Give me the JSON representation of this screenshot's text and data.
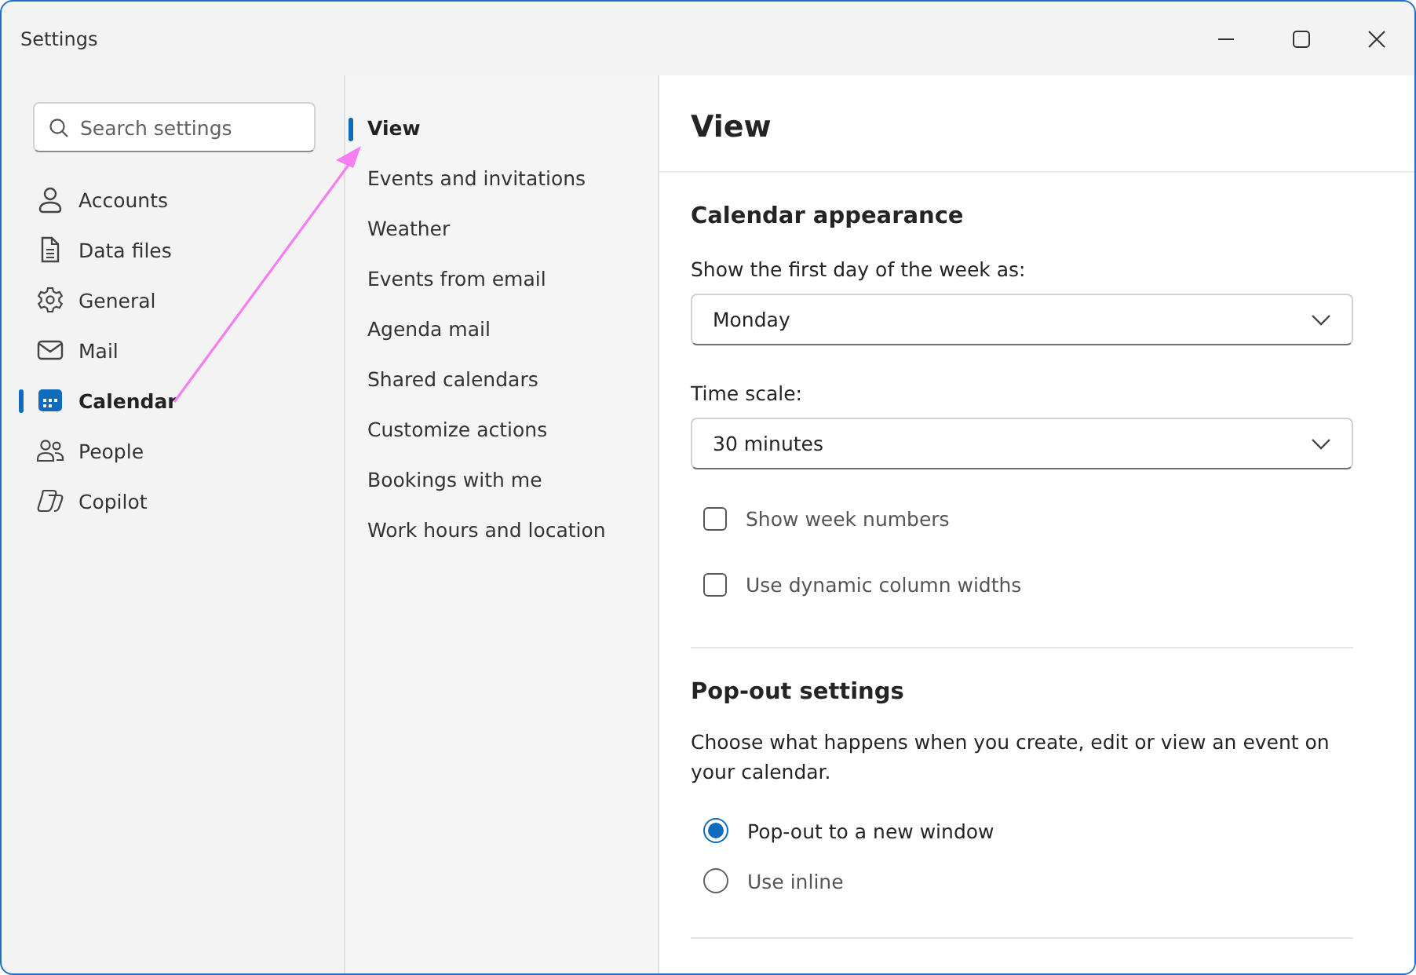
{
  "window": {
    "title": "Settings"
  },
  "search": {
    "placeholder": "Search settings"
  },
  "categories": [
    {
      "label": "Accounts",
      "selected": false
    },
    {
      "label": "Data files",
      "selected": false
    },
    {
      "label": "General",
      "selected": false
    },
    {
      "label": "Mail",
      "selected": false
    },
    {
      "label": "Calendar",
      "selected": true
    },
    {
      "label": "People",
      "selected": false
    },
    {
      "label": "Copilot",
      "selected": false
    }
  ],
  "subcategories": [
    {
      "label": "View",
      "selected": true
    },
    {
      "label": "Events and invitations",
      "selected": false
    },
    {
      "label": "Weather",
      "selected": false
    },
    {
      "label": "Events from email",
      "selected": false
    },
    {
      "label": "Agenda mail",
      "selected": false
    },
    {
      "label": "Shared calendars",
      "selected": false
    },
    {
      "label": "Customize actions",
      "selected": false
    },
    {
      "label": "Bookings with me",
      "selected": false
    },
    {
      "label": "Work hours and location",
      "selected": false
    }
  ],
  "page": {
    "title": "View",
    "appearance": {
      "heading": "Calendar appearance",
      "dropdowns": [
        {
          "label": "Show the first day of the week as:",
          "value": "Monday"
        },
        {
          "label": "Time scale:",
          "value": "30 minutes"
        }
      ],
      "checkboxes": [
        {
          "label": "Show week numbers",
          "checked": false
        },
        {
          "label": "Use dynamic column widths",
          "checked": false
        }
      ]
    },
    "popout": {
      "heading": "Pop-out settings",
      "description": "Choose what happens when you create, edit or view an event on your calendar.",
      "options": [
        {
          "label": "Pop-out to a new window",
          "selected": true
        },
        {
          "label": "Use inline",
          "selected": false
        }
      ]
    }
  }
}
